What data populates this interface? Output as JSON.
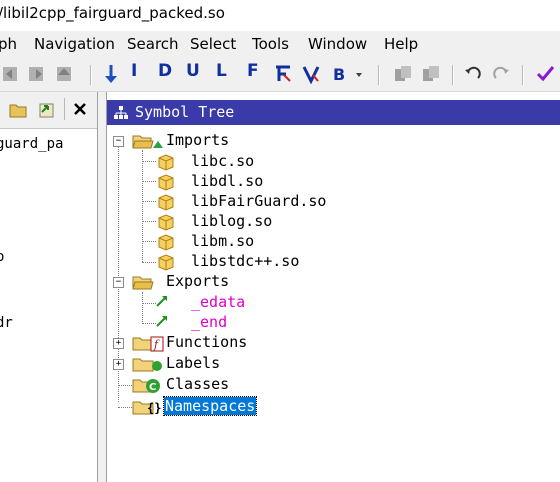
{
  "window": {
    "title": "/libil2cpp_fairguard_packed.so"
  },
  "menu": {
    "items": [
      "ph",
      "Navigation",
      "Search",
      "Select",
      "Tools",
      "Window",
      "Help"
    ]
  },
  "toolbar": {
    "letters": [
      "I",
      "D",
      "U",
      "L",
      "F"
    ]
  },
  "left_panel": {
    "lines": [
      "guard_pa",
      "o",
      "dr"
    ]
  },
  "symbol_tree": {
    "title": "Symbol Tree",
    "imports_label": "Imports",
    "imports": [
      "libc.so",
      "libdl.so",
      "libFairGuard.so",
      "liblog.so",
      "libm.so",
      "libstdc++.so"
    ],
    "exports_label": "Exports",
    "exports": [
      "_edata",
      "_end"
    ],
    "functions_label": "Functions",
    "labels_label": "Labels",
    "classes_label": "Classes",
    "namespaces_label": "Namespaces"
  },
  "colors": {
    "header": "#3a3aa8",
    "export_label": "#e000c8",
    "selection": "#0078d7"
  }
}
